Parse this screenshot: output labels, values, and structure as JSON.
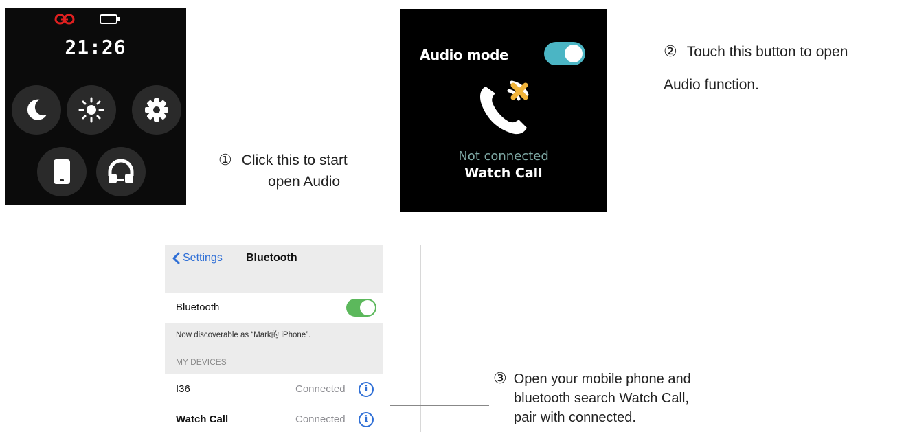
{
  "watch_menu": {
    "time": "21:26",
    "icons": [
      "link-icon",
      "battery-icon",
      "moon-icon",
      "brightness-icon",
      "gear-icon",
      "phone-icon",
      "headphones-icon"
    ],
    "accent_color": "#e02020"
  },
  "audio_screen": {
    "title": "Audio mode",
    "toggle_on": true,
    "toggle_color": "#4bb5c4",
    "status": "Not connected",
    "device_name": "Watch Call"
  },
  "callouts": [
    {
      "number": "①",
      "lines": [
        "Click this to start",
        "open Audio"
      ]
    },
    {
      "number": "②",
      "lines": [
        "Touch this button to open",
        "Audio function."
      ]
    },
    {
      "number": "③",
      "lines": [
        "Open your mobile phone and",
        "bluetooth search Watch Call,",
        "pair with connected."
      ]
    }
  ],
  "phone": {
    "back_label": "Settings",
    "title": "Bluetooth",
    "bluetooth_label": "Bluetooth",
    "bluetooth_on": true,
    "discoverable_text": "Now discoverable as “Mark的 iPhone”.",
    "section_header": "MY DEVICES",
    "devices": [
      {
        "name": "I36",
        "status": "Connected"
      },
      {
        "name": "Watch Call",
        "status": "Connected"
      }
    ]
  }
}
